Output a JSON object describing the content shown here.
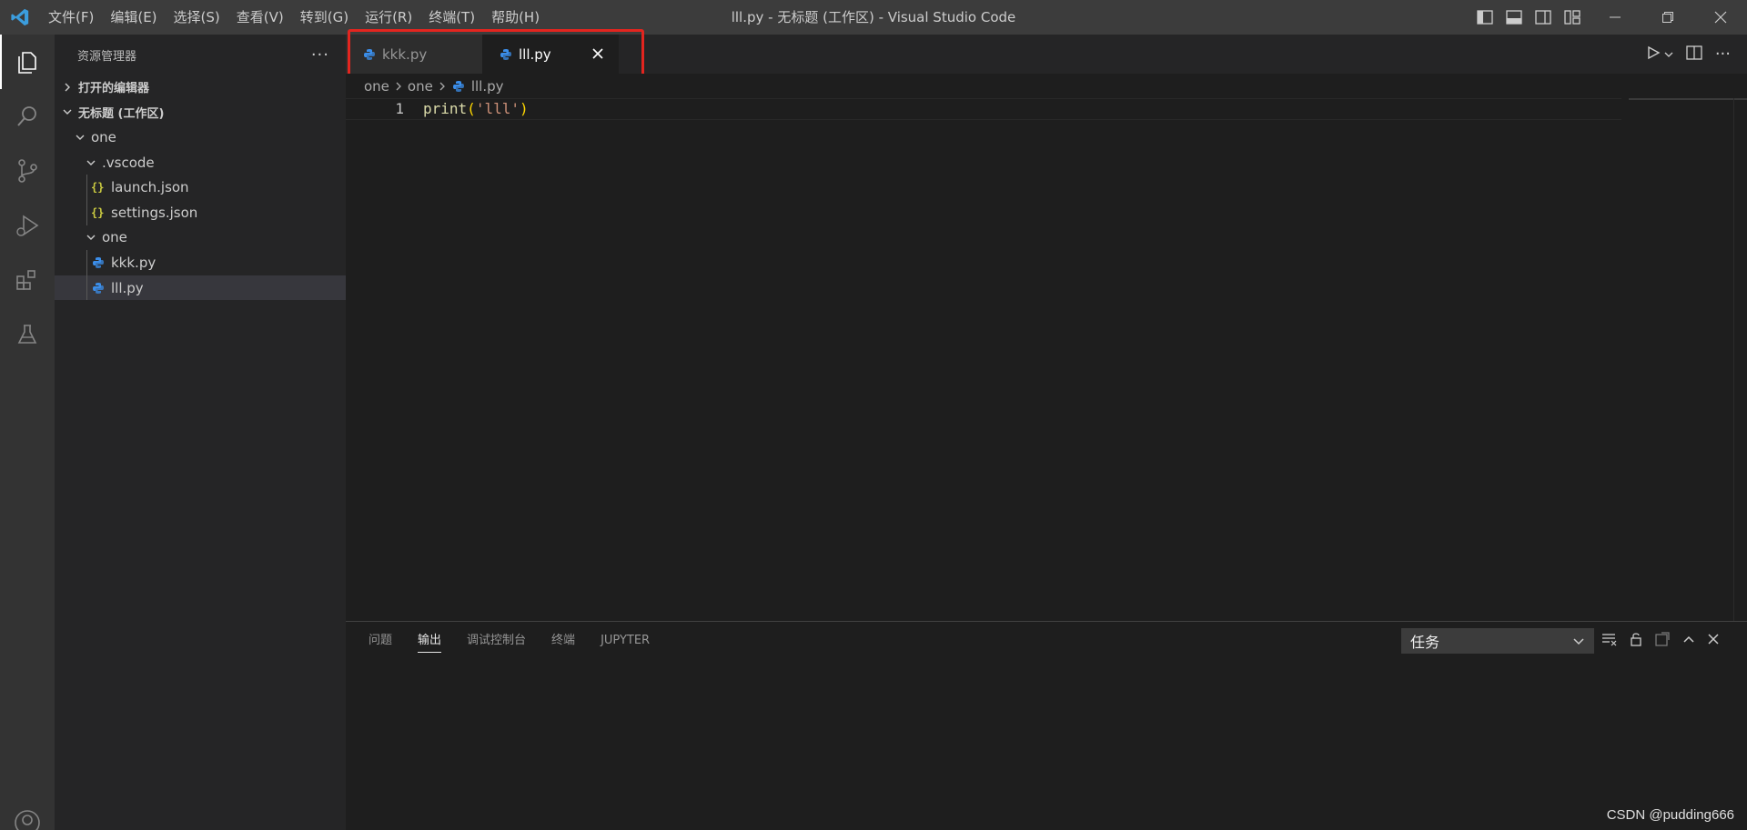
{
  "window": {
    "title": "lll.py - 无标题 (工作区) - Visual Studio Code",
    "menu": [
      "文件(F)",
      "编辑(E)",
      "选择(S)",
      "查看(V)",
      "转到(G)",
      "运行(R)",
      "终端(T)",
      "帮助(H)"
    ]
  },
  "sidebar": {
    "title": "资源管理器",
    "more": "···",
    "open_editors": "打开的编辑器",
    "workspace": "无标题 (工作区)",
    "tree": [
      {
        "label": "one",
        "kind": "folder",
        "depth": 0
      },
      {
        "label": ".vscode",
        "kind": "folder",
        "depth": 1
      },
      {
        "label": "launch.json",
        "kind": "json",
        "depth": 2
      },
      {
        "label": "settings.json",
        "kind": "json",
        "depth": 2
      },
      {
        "label": "one",
        "kind": "folder",
        "depth": 1
      },
      {
        "label": "kkk.py",
        "kind": "python",
        "depth": 2
      },
      {
        "label": "lll.py",
        "kind": "python",
        "depth": 2,
        "selected": true
      }
    ]
  },
  "tabs": [
    {
      "label": "kkk.py",
      "active": false
    },
    {
      "label": "lll.py",
      "active": true
    }
  ],
  "breadcrumb": [
    "one",
    "one",
    "lll.py"
  ],
  "code": {
    "line_number": "1",
    "fn": "print",
    "open": "(",
    "str": "'lll'",
    "close": ")"
  },
  "panel": {
    "tabs": [
      "问题",
      "输出",
      "调试控制台",
      "终端",
      "JUPYTER"
    ],
    "active_tab": "输出",
    "task_selected": "任务"
  },
  "watermark": "CSDN @pudding666",
  "colors": {
    "accent_red": "#e3251f",
    "python_blue": "#3b8eea",
    "json_yellow": "#cbcb41"
  }
}
